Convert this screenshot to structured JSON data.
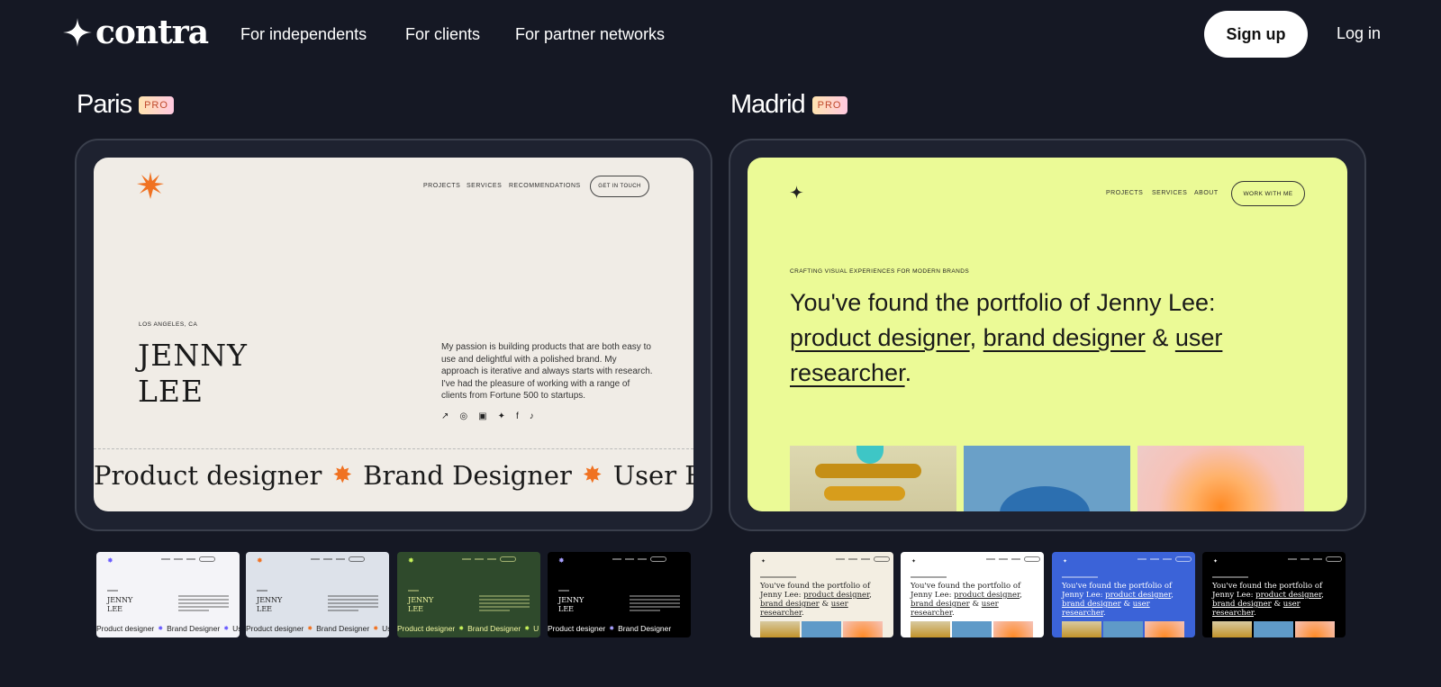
{
  "nav": {
    "logo_text": "contra",
    "links": [
      "For independents",
      "For clients",
      "For partner networks"
    ],
    "signup_label": "Sign up",
    "login_label": "Log in"
  },
  "templates": [
    {
      "name": "Paris",
      "badge": "PRO",
      "preview": {
        "nav": [
          "PROJECTS",
          "SERVICES",
          "RECOMMENDATIONS"
        ],
        "cta": "GET IN TOUCH",
        "location": "LOS ANGELES, CA",
        "name_line1": "JENNY",
        "name_line2": "LEE",
        "bio": "My passion is building products that are both easy to use and delightful with a polished brand. My approach is iterative and always starts with research. I've had the pleasure of working with a range of clients from Fortune 500 to startups.",
        "marquee": [
          "Product designer",
          "Brand Designer",
          "User Res"
        ],
        "accent": "#f07222"
      },
      "variants": [
        {
          "bg": "#f4f4f8",
          "fg": "#222222",
          "accent": "#6a5cff",
          "marquee": [
            "Product designer",
            "Brand Designer",
            "User"
          ]
        },
        {
          "bg": "#dde2ea",
          "fg": "#222222",
          "accent": "#f07222",
          "marquee": [
            "Product designer",
            "Brand Designer",
            "User Res"
          ]
        },
        {
          "bg": "#2f4a2c",
          "fg": "#f2f7a0",
          "accent": "#c8f25a",
          "marquee": [
            "Product designer",
            "Brand Designer",
            "U"
          ]
        },
        {
          "bg": "#000000",
          "fg": "#ffffff",
          "accent": "#a8a0ff",
          "marquee": [
            "Product designer",
            "Brand Designer"
          ]
        }
      ]
    },
    {
      "name": "Madrid",
      "badge": "PRO",
      "preview": {
        "nav": [
          "PROJECTS",
          "SERVICES",
          "ABOUT"
        ],
        "cta": "WORK WITH ME",
        "subheading": "CRAFTING VISUAL EXPERIENCES FOR MODERN BRANDS",
        "headline_prefix": "You've found the portfolio of Jenny Lee:",
        "role1": "product designer",
        "role2": "brand designer",
        "amp": "&",
        "role3": "user researcher",
        "period": "."
      },
      "variants": [
        {
          "bg": "#f3eee2",
          "fg": "#222222"
        },
        {
          "bg": "#ffffff",
          "fg": "#222222"
        },
        {
          "bg": "#3b63d8",
          "fg": "#ffffff"
        },
        {
          "bg": "#000000",
          "fg": "#ffffff"
        }
      ],
      "thumb_text": {
        "prefix": "You've found the portfolio of Jenny Lee:",
        "role1": "product designer",
        "role2": "brand designer",
        "amp": "&",
        "role3": "user researcher"
      }
    }
  ]
}
